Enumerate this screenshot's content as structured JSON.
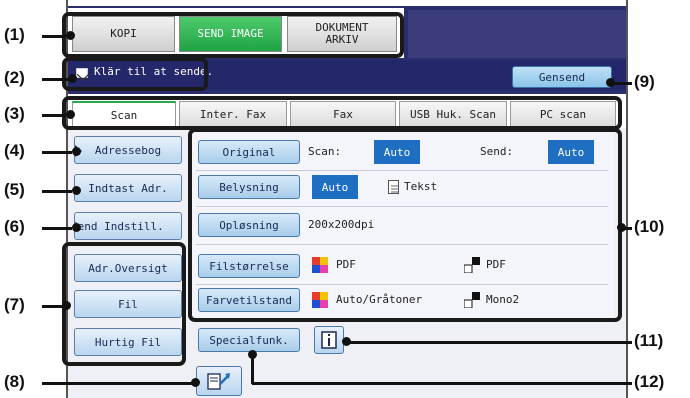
{
  "callouts": [
    "(1)",
    "(2)",
    "(3)",
    "(4)",
    "(5)",
    "(6)",
    "(7)",
    "(8)",
    "(9)",
    "(10)",
    "(11)",
    "(12)"
  ],
  "modes": {
    "kopi": "KOPI",
    "send_image": "SEND IMAGE",
    "dokument_arkiv_line1": "DOKUMENT",
    "dokument_arkiv_line2": "ARKIV"
  },
  "status": {
    "message": "Klär til at sende."
  },
  "gensend_label": "Gensend",
  "tabs": [
    "Scan",
    "Inter. Fax",
    "Fax",
    "USB Huk. Scan",
    "PC scan"
  ],
  "side_buttons": [
    "Adressebog",
    "Indtast Adr.",
    "Send Indstill.",
    "Adr.Oversigt",
    "Fil",
    "Hurtig Fil"
  ],
  "settings": {
    "original_label": "Original",
    "scan_label": "Scan:",
    "scan_value": "Auto",
    "send_label": "Send:",
    "send_value": "Auto",
    "belysning_label": "Belysning",
    "belysning_value": "Auto",
    "belysning_mode": "Tekst",
    "oplosning_label": "Opløsning",
    "oplosning_value": "200x200dpi",
    "filstorrelse_label": "Filstørrelse",
    "filstorrelse_color_value": "PDF",
    "filstorrelse_mono_value": "PDF",
    "farvetilstand_label": "Farvetilstand",
    "farvetilstand_color_value": "Auto/Gråtoner",
    "farvetilstand_mono_value": "Mono2"
  },
  "specialfunk_label": "Specialfunk.",
  "colors": {
    "panel": "#2a2d6e",
    "active_mode": "#2fb050",
    "auto_chip": "#1e6fc2",
    "button": "#b9d5ee"
  },
  "icons": [
    "envelope-icon",
    "tab-arrow-icon",
    "document-icon",
    "color-squares-icon",
    "mono-squares-icon",
    "info-icon",
    "address-book-icon"
  ]
}
